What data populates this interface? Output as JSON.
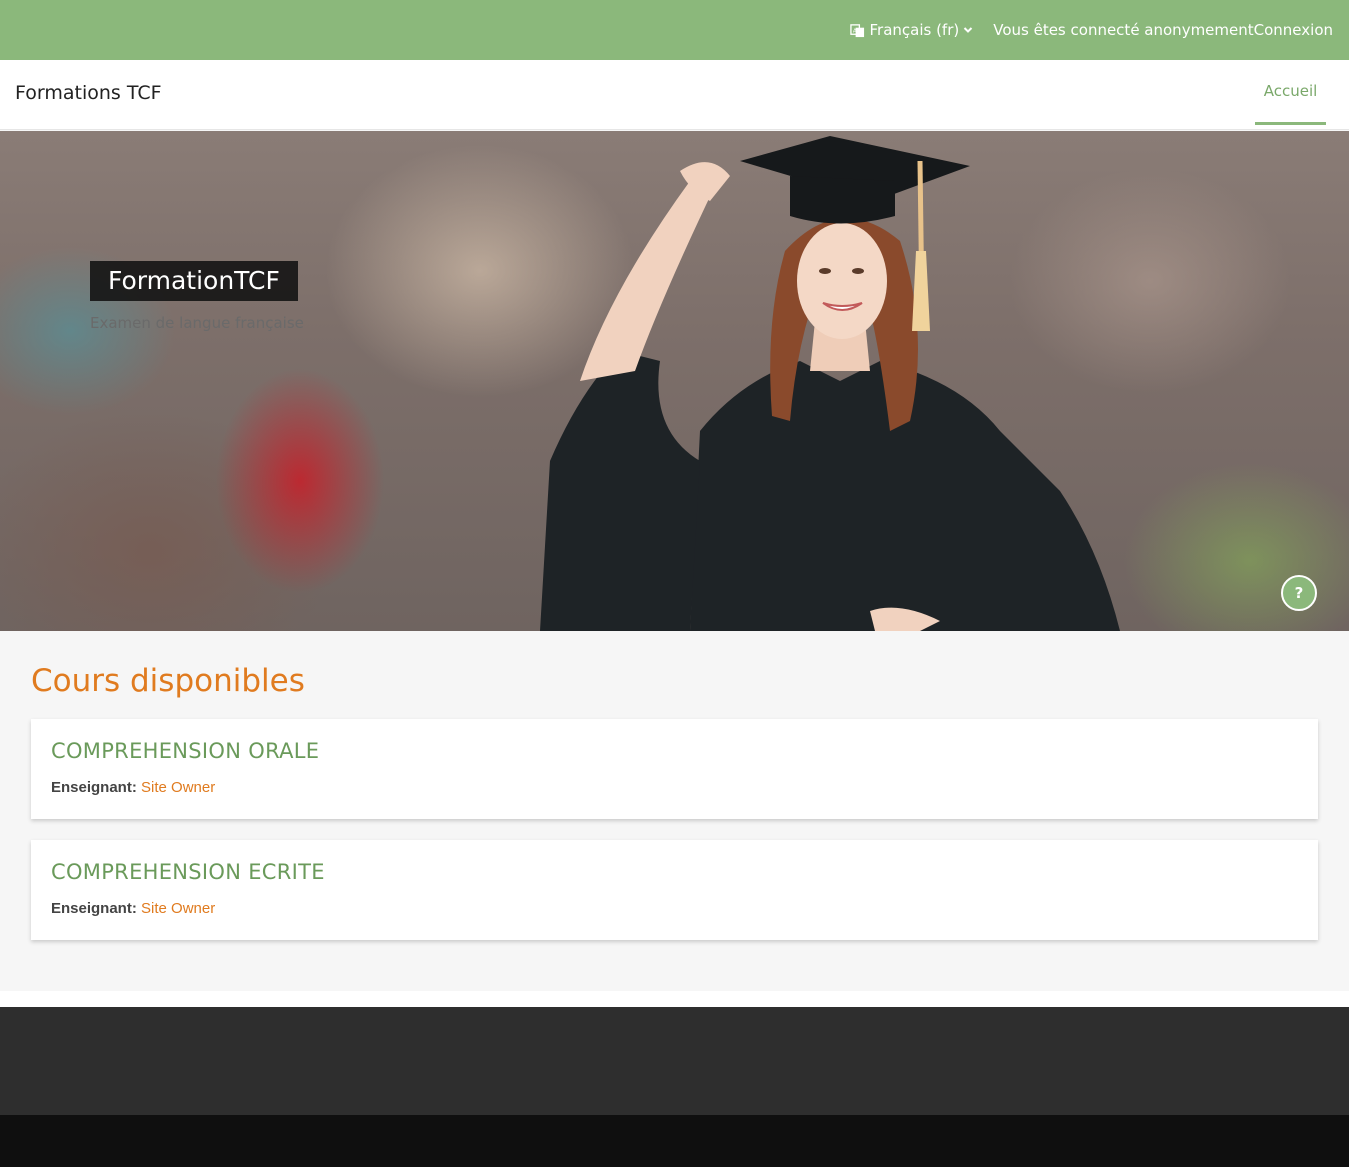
{
  "topbar": {
    "language_label": "Français ‎(fr)‎",
    "language_icon": "language-icon",
    "login_status": "Vous êtes connecté anonymement",
    "login_link": "Connexion"
  },
  "navbar": {
    "brand": "Formations TCF",
    "home_label": "Accueil"
  },
  "hero": {
    "title": "FormationTCF",
    "subtitle": "Examen de langue française",
    "help_label": "?"
  },
  "courses": {
    "title": "Cours disponibles",
    "items": [
      {
        "name": "COMPREHENSION ORALE",
        "teacher_label": "Enseignant:",
        "teacher_name": "Site Owner"
      },
      {
        "name": "COMPREHENSION ECRITE",
        "teacher_label": "Enseignant:",
        "teacher_name": "Site Owner"
      }
    ]
  },
  "colors": {
    "accent_green": "#8bb87b",
    "accent_orange": "#e07b1f",
    "footer_dark": "#2e2e2e"
  }
}
